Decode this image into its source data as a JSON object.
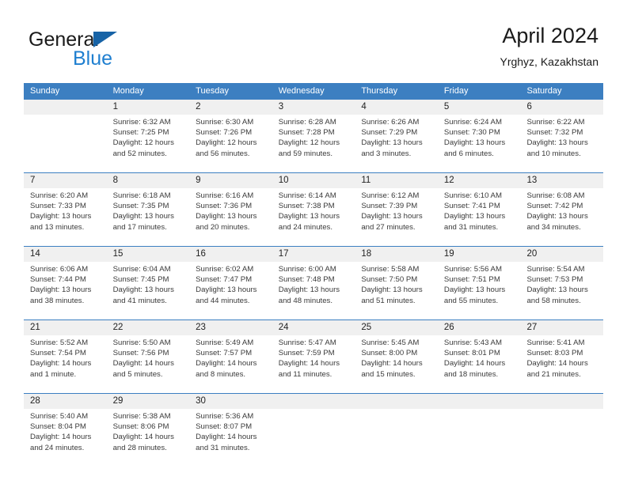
{
  "brand": {
    "name_top": "General",
    "name_bottom": "Blue",
    "triangle_color": "#1763a6",
    "blue_color": "#1f7fd0"
  },
  "header": {
    "title": "April 2024",
    "subtitle": "Yrghyz, Kazakhstan"
  },
  "theme": {
    "header_bg": "#3c7fc1",
    "daynum_bg": "#f0f0f0",
    "week_divider": "#3c7fc1",
    "text": "#222222"
  },
  "weekdays": [
    "Sunday",
    "Monday",
    "Tuesday",
    "Wednesday",
    "Thursday",
    "Friday",
    "Saturday"
  ],
  "weeks": [
    {
      "days": [
        {
          "num": "",
          "sunrise": "",
          "sunset": "",
          "daylight1": "",
          "daylight2": ""
        },
        {
          "num": "1",
          "sunrise": "Sunrise: 6:32 AM",
          "sunset": "Sunset: 7:25 PM",
          "daylight1": "Daylight: 12 hours",
          "daylight2": "and 52 minutes."
        },
        {
          "num": "2",
          "sunrise": "Sunrise: 6:30 AM",
          "sunset": "Sunset: 7:26 PM",
          "daylight1": "Daylight: 12 hours",
          "daylight2": "and 56 minutes."
        },
        {
          "num": "3",
          "sunrise": "Sunrise: 6:28 AM",
          "sunset": "Sunset: 7:28 PM",
          "daylight1": "Daylight: 12 hours",
          "daylight2": "and 59 minutes."
        },
        {
          "num": "4",
          "sunrise": "Sunrise: 6:26 AM",
          "sunset": "Sunset: 7:29 PM",
          "daylight1": "Daylight: 13 hours",
          "daylight2": "and 3 minutes."
        },
        {
          "num": "5",
          "sunrise": "Sunrise: 6:24 AM",
          "sunset": "Sunset: 7:30 PM",
          "daylight1": "Daylight: 13 hours",
          "daylight2": "and 6 minutes."
        },
        {
          "num": "6",
          "sunrise": "Sunrise: 6:22 AM",
          "sunset": "Sunset: 7:32 PM",
          "daylight1": "Daylight: 13 hours",
          "daylight2": "and 10 minutes."
        }
      ]
    },
    {
      "days": [
        {
          "num": "7",
          "sunrise": "Sunrise: 6:20 AM",
          "sunset": "Sunset: 7:33 PM",
          "daylight1": "Daylight: 13 hours",
          "daylight2": "and 13 minutes."
        },
        {
          "num": "8",
          "sunrise": "Sunrise: 6:18 AM",
          "sunset": "Sunset: 7:35 PM",
          "daylight1": "Daylight: 13 hours",
          "daylight2": "and 17 minutes."
        },
        {
          "num": "9",
          "sunrise": "Sunrise: 6:16 AM",
          "sunset": "Sunset: 7:36 PM",
          "daylight1": "Daylight: 13 hours",
          "daylight2": "and 20 minutes."
        },
        {
          "num": "10",
          "sunrise": "Sunrise: 6:14 AM",
          "sunset": "Sunset: 7:38 PM",
          "daylight1": "Daylight: 13 hours",
          "daylight2": "and 24 minutes."
        },
        {
          "num": "11",
          "sunrise": "Sunrise: 6:12 AM",
          "sunset": "Sunset: 7:39 PM",
          "daylight1": "Daylight: 13 hours",
          "daylight2": "and 27 minutes."
        },
        {
          "num": "12",
          "sunrise": "Sunrise: 6:10 AM",
          "sunset": "Sunset: 7:41 PM",
          "daylight1": "Daylight: 13 hours",
          "daylight2": "and 31 minutes."
        },
        {
          "num": "13",
          "sunrise": "Sunrise: 6:08 AM",
          "sunset": "Sunset: 7:42 PM",
          "daylight1": "Daylight: 13 hours",
          "daylight2": "and 34 minutes."
        }
      ]
    },
    {
      "days": [
        {
          "num": "14",
          "sunrise": "Sunrise: 6:06 AM",
          "sunset": "Sunset: 7:44 PM",
          "daylight1": "Daylight: 13 hours",
          "daylight2": "and 38 minutes."
        },
        {
          "num": "15",
          "sunrise": "Sunrise: 6:04 AM",
          "sunset": "Sunset: 7:45 PM",
          "daylight1": "Daylight: 13 hours",
          "daylight2": "and 41 minutes."
        },
        {
          "num": "16",
          "sunrise": "Sunrise: 6:02 AM",
          "sunset": "Sunset: 7:47 PM",
          "daylight1": "Daylight: 13 hours",
          "daylight2": "and 44 minutes."
        },
        {
          "num": "17",
          "sunrise": "Sunrise: 6:00 AM",
          "sunset": "Sunset: 7:48 PM",
          "daylight1": "Daylight: 13 hours",
          "daylight2": "and 48 minutes."
        },
        {
          "num": "18",
          "sunrise": "Sunrise: 5:58 AM",
          "sunset": "Sunset: 7:50 PM",
          "daylight1": "Daylight: 13 hours",
          "daylight2": "and 51 minutes."
        },
        {
          "num": "19",
          "sunrise": "Sunrise: 5:56 AM",
          "sunset": "Sunset: 7:51 PM",
          "daylight1": "Daylight: 13 hours",
          "daylight2": "and 55 minutes."
        },
        {
          "num": "20",
          "sunrise": "Sunrise: 5:54 AM",
          "sunset": "Sunset: 7:53 PM",
          "daylight1": "Daylight: 13 hours",
          "daylight2": "and 58 minutes."
        }
      ]
    },
    {
      "days": [
        {
          "num": "21",
          "sunrise": "Sunrise: 5:52 AM",
          "sunset": "Sunset: 7:54 PM",
          "daylight1": "Daylight: 14 hours",
          "daylight2": "and 1 minute."
        },
        {
          "num": "22",
          "sunrise": "Sunrise: 5:50 AM",
          "sunset": "Sunset: 7:56 PM",
          "daylight1": "Daylight: 14 hours",
          "daylight2": "and 5 minutes."
        },
        {
          "num": "23",
          "sunrise": "Sunrise: 5:49 AM",
          "sunset": "Sunset: 7:57 PM",
          "daylight1": "Daylight: 14 hours",
          "daylight2": "and 8 minutes."
        },
        {
          "num": "24",
          "sunrise": "Sunrise: 5:47 AM",
          "sunset": "Sunset: 7:59 PM",
          "daylight1": "Daylight: 14 hours",
          "daylight2": "and 11 minutes."
        },
        {
          "num": "25",
          "sunrise": "Sunrise: 5:45 AM",
          "sunset": "Sunset: 8:00 PM",
          "daylight1": "Daylight: 14 hours",
          "daylight2": "and 15 minutes."
        },
        {
          "num": "26",
          "sunrise": "Sunrise: 5:43 AM",
          "sunset": "Sunset: 8:01 PM",
          "daylight1": "Daylight: 14 hours",
          "daylight2": "and 18 minutes."
        },
        {
          "num": "27",
          "sunrise": "Sunrise: 5:41 AM",
          "sunset": "Sunset: 8:03 PM",
          "daylight1": "Daylight: 14 hours",
          "daylight2": "and 21 minutes."
        }
      ]
    },
    {
      "days": [
        {
          "num": "28",
          "sunrise": "Sunrise: 5:40 AM",
          "sunset": "Sunset: 8:04 PM",
          "daylight1": "Daylight: 14 hours",
          "daylight2": "and 24 minutes."
        },
        {
          "num": "29",
          "sunrise": "Sunrise: 5:38 AM",
          "sunset": "Sunset: 8:06 PM",
          "daylight1": "Daylight: 14 hours",
          "daylight2": "and 28 minutes."
        },
        {
          "num": "30",
          "sunrise": "Sunrise: 5:36 AM",
          "sunset": "Sunset: 8:07 PM",
          "daylight1": "Daylight: 14 hours",
          "daylight2": "and 31 minutes."
        },
        {
          "num": "",
          "sunrise": "",
          "sunset": "",
          "daylight1": "",
          "daylight2": ""
        },
        {
          "num": "",
          "sunrise": "",
          "sunset": "",
          "daylight1": "",
          "daylight2": ""
        },
        {
          "num": "",
          "sunrise": "",
          "sunset": "",
          "daylight1": "",
          "daylight2": ""
        },
        {
          "num": "",
          "sunrise": "",
          "sunset": "",
          "daylight1": "",
          "daylight2": ""
        }
      ]
    }
  ]
}
